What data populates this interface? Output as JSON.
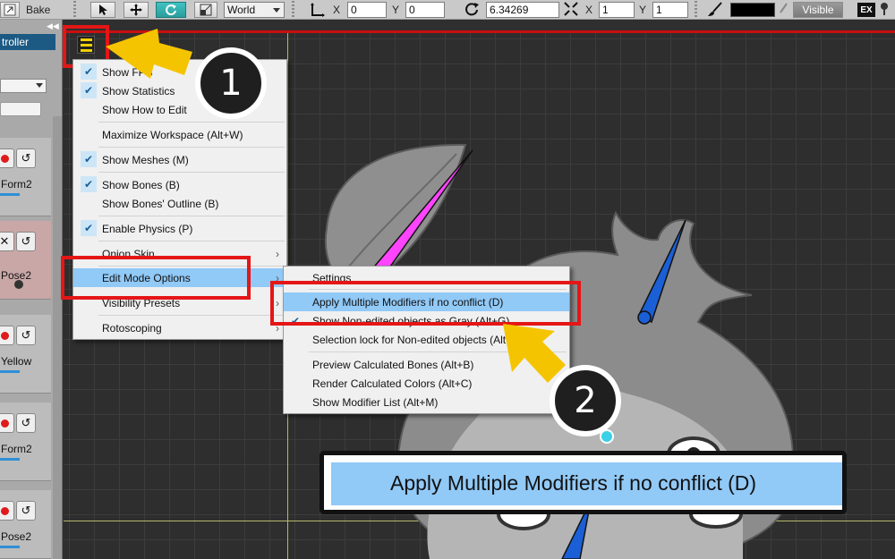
{
  "toolbar": {
    "bake_label": "Bake",
    "coord_space": "World",
    "pos_x_label": "X",
    "pos_x": "0",
    "pos_y_label": "Y",
    "pos_y": "0",
    "rotation": "6.34269",
    "scale_x_label": "X",
    "scale_x": "1",
    "scale_y_label": "Y",
    "scale_y": "1",
    "visible_label": "Visible",
    "ex_label": "EX"
  },
  "left_panel": {
    "header": "troller",
    "cards": [
      {
        "label": "Form2"
      },
      {
        "label": "Pose2"
      },
      {
        "label": "Yellow"
      },
      {
        "label": "Form2"
      },
      {
        "label": "Pose2"
      }
    ]
  },
  "main_menu": {
    "items": [
      {
        "label": "Show FPS",
        "checked": true
      },
      {
        "label": "Show Statistics",
        "checked": true
      },
      {
        "label": "Show How to Edit",
        "checked": false
      },
      {
        "label": "Maximize Workspace (Alt+W)",
        "checked": false
      },
      {
        "label": "Show Meshes (M)",
        "checked": true
      },
      {
        "label": "Show Bones (B)",
        "checked": true
      },
      {
        "label": "Show Bones' Outline (B)",
        "checked": false
      },
      {
        "label": "Enable Physics (P)",
        "checked": true
      },
      {
        "label": "Onion Skin",
        "checked": false
      },
      {
        "label": "Edit Mode Options",
        "checked": false
      },
      {
        "label": "Visibility Presets",
        "checked": false
      },
      {
        "label": "Rotoscoping",
        "checked": false
      }
    ]
  },
  "submenu": {
    "items": [
      {
        "label": "Settings"
      },
      {
        "label": "Apply Multiple Modifiers if no conflict (D)"
      },
      {
        "label": "Show Non-edited objects as Gray (Alt+G)"
      },
      {
        "label": "Selection lock for Non-edited objects (Alt+L)"
      },
      {
        "label": "Preview Calculated Bones (Alt+B)"
      },
      {
        "label": "Render Calculated Colors (Alt+C)"
      },
      {
        "label": "Show Modifier List (Alt+M)"
      }
    ]
  },
  "callouts": {
    "step1": "1",
    "step2": "2",
    "zoom_text": "Apply Multiple Modifiers if no conflict (D)"
  },
  "colors": {
    "highlight_red": "#e51616",
    "arrow_yellow": "#f5c400",
    "menu_hover": "#91c9f7",
    "bone_magenta": "#ff44ff",
    "bone_blue": "#1b5fd6"
  }
}
